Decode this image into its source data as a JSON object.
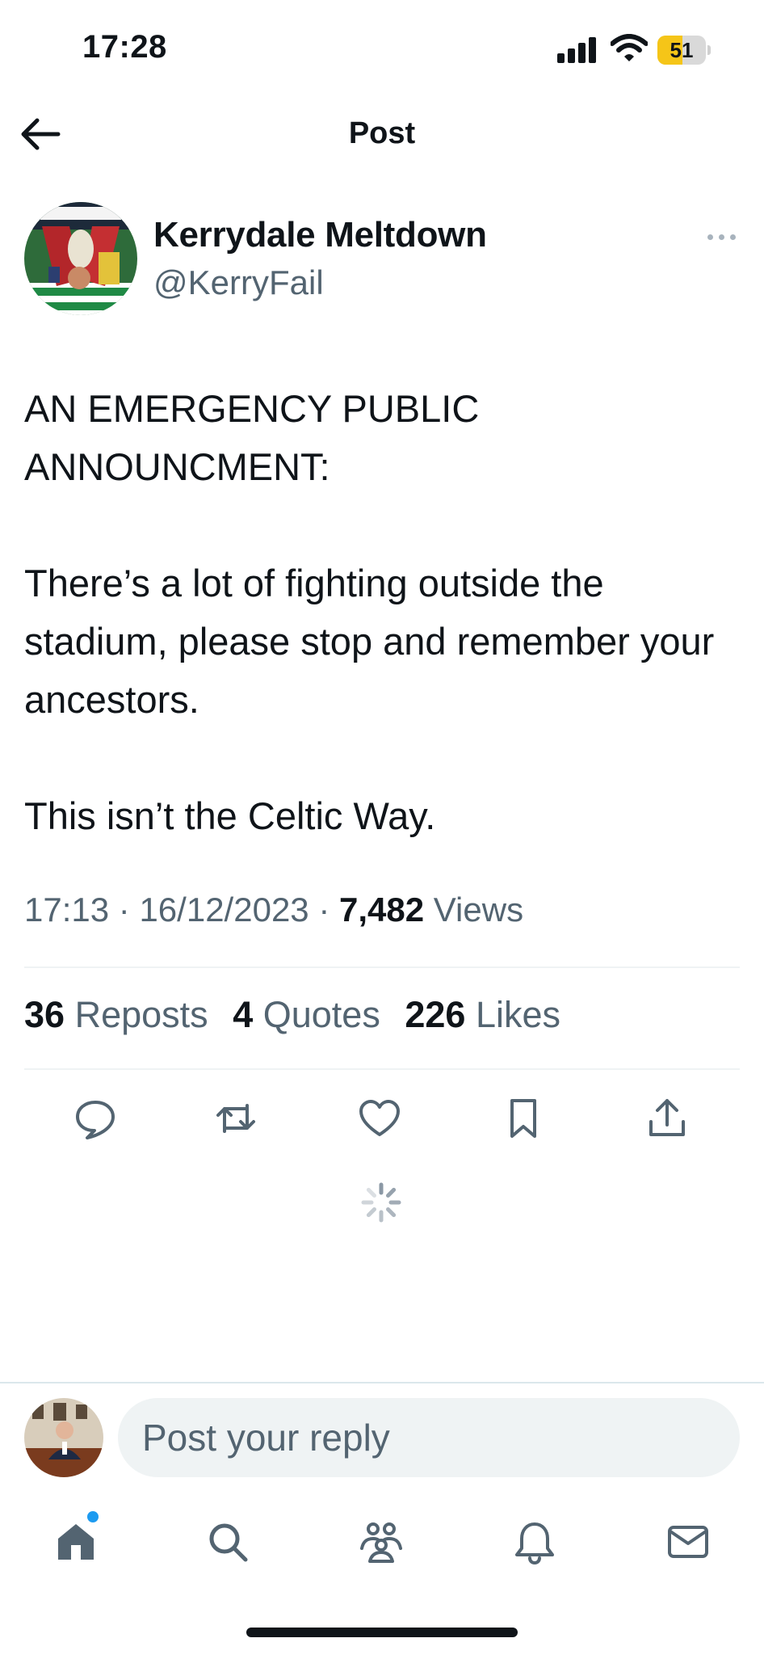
{
  "status_bar": {
    "time": "17:28",
    "battery_level": "51",
    "battery_fraction": 0.51,
    "icons": [
      "cellular-signal-icon",
      "wifi-icon",
      "battery-icon"
    ]
  },
  "header": {
    "title": "Post",
    "back_icon": "arrow-left-icon"
  },
  "post": {
    "author_name": "Kerrydale Meltdown",
    "author_handle": "@KerryFail",
    "more_icon": "more-horizontal-icon",
    "body": "AN EMERGENCY PUBLIC\nANNOUNCMENT:\n\nThere’s a lot of fighting outside the stadium, please stop and remember your ancestors.\n\nThis isn’t the Celtic Way.",
    "time": "17:13",
    "separator": "·",
    "date": "16/12/2023",
    "views_count": "7,482",
    "views_label": "Views",
    "reposts_count": "36",
    "reposts_label": "Reposts",
    "quotes_count": "4",
    "quotes_label": "Quotes",
    "likes_count": "226",
    "likes_label": "Likes"
  },
  "actions": [
    {
      "icon": "reply-icon"
    },
    {
      "icon": "repost-icon"
    },
    {
      "icon": "like-heart-icon"
    },
    {
      "icon": "bookmark-icon"
    },
    {
      "icon": "share-icon"
    }
  ],
  "reply": {
    "placeholder": "Post your reply"
  },
  "bottom_nav": [
    {
      "icon": "home-icon",
      "has_notification_dot": true
    },
    {
      "icon": "search-icon"
    },
    {
      "icon": "communities-icon"
    },
    {
      "icon": "notifications-bell-icon"
    },
    {
      "icon": "messages-envelope-icon"
    }
  ],
  "colors": {
    "text_primary": "#0f1419",
    "text_secondary": "#536471",
    "accent": "#1d9bf0",
    "divider": "#eff3f4",
    "battery_fill": "#f5c518",
    "icon_gray": "#536471"
  }
}
